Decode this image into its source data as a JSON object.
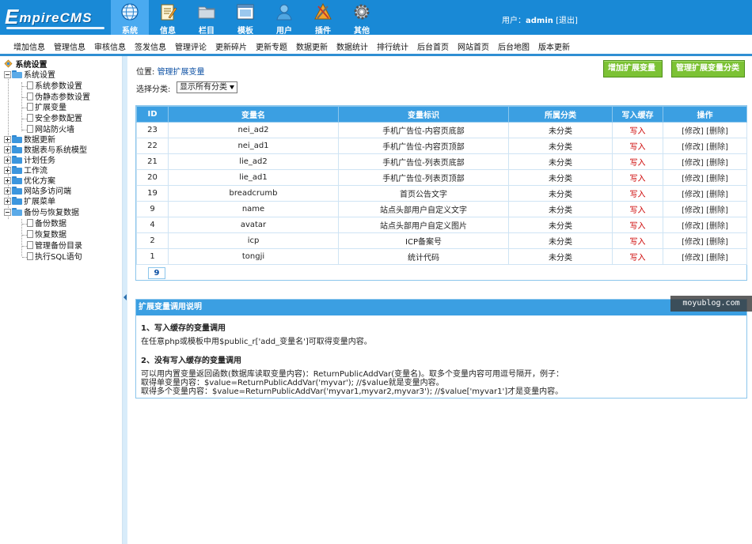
{
  "app": {
    "logo_letter": "E",
    "logo_text": "mpireCMS"
  },
  "nav_tabs": [
    {
      "label": "系统",
      "icon": "globe-icon"
    },
    {
      "label": "信息",
      "icon": "notepad-icon"
    },
    {
      "label": "栏目",
      "icon": "folder-icon"
    },
    {
      "label": "模板",
      "icon": "window-icon"
    },
    {
      "label": "用户",
      "icon": "user-icon"
    },
    {
      "label": "插件",
      "icon": "tools-icon"
    },
    {
      "label": "其他",
      "icon": "gear-icon"
    }
  ],
  "userbar": {
    "prefix": "用户：",
    "username": "admin",
    "logout": "[退出]"
  },
  "submenu": [
    "增加信息",
    "管理信息",
    "审核信息",
    "签发信息",
    "管理评论",
    "更新碎片",
    "更新专题",
    "数据更新",
    "数据统计",
    "排行统计",
    "后台首页",
    "网站首页",
    "后台地图",
    "版本更新"
  ],
  "sidebar": {
    "root": "系统设置",
    "tree": [
      {
        "label": "系统设置",
        "children": [
          "系统参数设置",
          "伪静态参数设置",
          "扩展变量",
          "安全参数配置",
          "网站防火墙"
        ]
      },
      {
        "label": "数据更新"
      },
      {
        "label": "数据表与系统模型"
      },
      {
        "label": "计划任务"
      },
      {
        "label": "工作流"
      },
      {
        "label": "优化方案"
      },
      {
        "label": "网站多访问端"
      },
      {
        "label": "扩展菜单"
      },
      {
        "label": "备份与恢复数据",
        "children": [
          "备份数据",
          "恢复数据",
          "管理备份目录",
          "执行SQL语句"
        ]
      }
    ]
  },
  "main": {
    "location_prefix": "位置:",
    "location_link": "管理扩展变量",
    "btn_add": "增加扩展变量",
    "btn_manage_class": "管理扩展变量分类",
    "filter_label": "选择分类:",
    "filter_value": "显示所有分类",
    "table": {
      "headers": [
        "ID",
        "变量名",
        "变量标识",
        "所属分类",
        "写入缓存",
        "操作"
      ],
      "rows": [
        {
          "id": "23",
          "name": "nei_ad2",
          "tag": "手机广告位-内容页底部",
          "cls": "未分类",
          "cache": "写入",
          "edit": "[修改]",
          "del": "[删除]"
        },
        {
          "id": "22",
          "name": "nei_ad1",
          "tag": "手机广告位-内容页顶部",
          "cls": "未分类",
          "cache": "写入",
          "edit": "[修改]",
          "del": "[删除]"
        },
        {
          "id": "21",
          "name": "lie_ad2",
          "tag": "手机广告位-列表页底部",
          "cls": "未分类",
          "cache": "写入",
          "edit": "[修改]",
          "del": "[删除]"
        },
        {
          "id": "20",
          "name": "lie_ad1",
          "tag": "手机广告位-列表页顶部",
          "cls": "未分类",
          "cache": "写入",
          "edit": "[修改]",
          "del": "[删除]"
        },
        {
          "id": "19",
          "name": "breadcrumb",
          "tag": "首页公告文字",
          "cls": "未分类",
          "cache": "写入",
          "edit": "[修改]",
          "del": "[删除]"
        },
        {
          "id": "9",
          "name": "name",
          "tag": "站点头部用户自定义文字",
          "cls": "未分类",
          "cache": "写入",
          "edit": "[修改]",
          "del": "[删除]"
        },
        {
          "id": "4",
          "name": "avatar",
          "tag": "站点头部用户自定义图片",
          "cls": "未分类",
          "cache": "写入",
          "edit": "[修改]",
          "del": "[删除]"
        },
        {
          "id": "2",
          "name": "icp",
          "tag": "ICP备案号",
          "cls": "未分类",
          "cache": "写入",
          "edit": "[修改]",
          "del": "[删除]"
        },
        {
          "id": "1",
          "name": "tongji",
          "tag": "统计代码",
          "cls": "未分类",
          "cache": "写入",
          "edit": "[修改]",
          "del": "[删除]"
        }
      ],
      "total": "9"
    },
    "help": {
      "title": "扩展变量调用说明",
      "h1": "1、写入缓存的变量调用",
      "p1": "在任意php或模板中用$public_r['add_变量名']可取得变量内容。",
      "h2": "2、没有写入缓存的变量调用",
      "p2a": "可以用内置变量返回函数(数据库读取变量内容)：ReturnPublicAddVar(变量名)。取多个变量内容可用逗号隔开，例子：",
      "p2b": "取得单变量内容：$value=ReturnPublicAddVar('myvar'); //$value就是变量内容。",
      "p2c": "取得多个变量内容：$value=ReturnPublicAddVar('myvar1,myvar2,myvar3'); //$value['myvar1']才是变量内容。"
    }
  },
  "watermark": "moyublog.com"
}
